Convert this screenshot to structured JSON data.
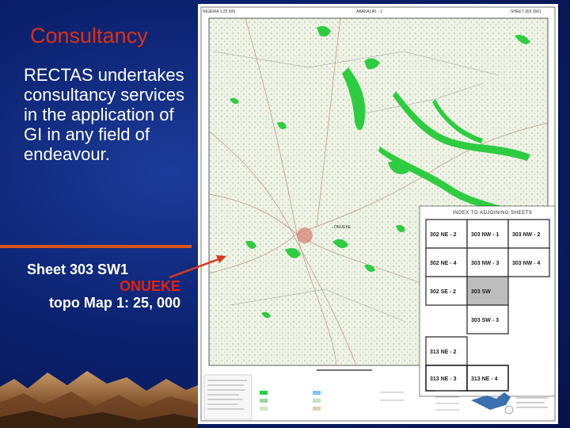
{
  "slide": {
    "title": "Consultancy",
    "body": "RECTAS undertakes consultancy services in the application of GI in any field of endeavour.",
    "caption": {
      "line1": "Sheet 303 SW1",
      "line2": "ONUEKE",
      "line3": "topo Map",
      "line4": "1: 25, 000"
    }
  },
  "map": {
    "header_left": "NIGERIA  1:25 000",
    "header_center": "ABAKALIKI - 1",
    "header_right": "SHEET 303 SW1",
    "index_title": "INDEX TO ADJOINING SHEETS",
    "index_cells": {
      "r1c1": "302 NE - 2",
      "r1c2": "303 NW - 1",
      "r1c3": "303 NW - 2",
      "r2c1": "302 NE - 4",
      "r2c2": "303 NW - 3",
      "r2c3": "303 NW - 4",
      "r3c1": "302 SE - 2",
      "r3c2": "303 SW",
      "r4c2": "303 SW - 3",
      "r5c1": "313 NE - 2",
      "r6c1": "313 NE - 3",
      "r6c2": "313 NE - 4"
    },
    "town_label": "ONUEKE"
  },
  "colors": {
    "background": "#0c2270",
    "title": "#e03010",
    "highlight": "#e8200c",
    "rule": "#d9541c",
    "forest": "#2ecc40"
  }
}
